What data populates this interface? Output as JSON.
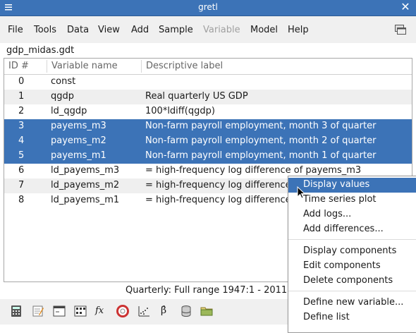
{
  "window": {
    "title": "gretl"
  },
  "menubar": {
    "items": [
      "File",
      "Tools",
      "Data",
      "View",
      "Add",
      "Sample",
      "Variable",
      "Model",
      "Help"
    ],
    "disabled_item": "Variable"
  },
  "dataset": {
    "filename": "gdp_midas.gdt"
  },
  "table": {
    "headers": [
      "ID #",
      "Variable name",
      "Descriptive label"
    ],
    "rows": [
      {
        "id": "0",
        "name": "const",
        "label": ""
      },
      {
        "id": "1",
        "name": "qgdp",
        "label": "Real quarterly US GDP"
      },
      {
        "id": "2",
        "name": "ld_qgdp",
        "label": "100*ldiff(qgdp)"
      },
      {
        "id": "3",
        "name": "payems_m3",
        "label": "Non-farm payroll employment, month 3 of quarter"
      },
      {
        "id": "4",
        "name": "payems_m2",
        "label": "Non-farm payroll employment, month 2 of quarter"
      },
      {
        "id": "5",
        "name": "payems_m1",
        "label": "Non-farm payroll employment, month 1 of quarter"
      },
      {
        "id": "6",
        "name": "ld_payems_m3",
        "label": "= high-frequency log difference of payems_m3"
      },
      {
        "id": "7",
        "name": "ld_payems_m2",
        "label": "= high-frequency log difference"
      },
      {
        "id": "8",
        "name": "ld_payems_m1",
        "label": "= high-frequency log difference"
      }
    ]
  },
  "status": {
    "text": "Quarterly: Full range 1947:1 - 2011:"
  },
  "context_menu": {
    "items": [
      "Display values",
      "Time series plot",
      "Add logs...",
      "Add differences...",
      "Display components",
      "Edit components",
      "Delete components",
      "Define new variable...",
      "Define list"
    ],
    "highlighted": "Display values"
  },
  "colors": {
    "selection": "#3c73b7",
    "titlebar": "#3c73b7"
  },
  "toolbar": {
    "icons": [
      "calculator-icon",
      "notepad-icon",
      "terminal-icon",
      "session-icon",
      "function-icon",
      "help-icon",
      "graph-icon",
      "beta-icon",
      "database-icon",
      "folder-icon"
    ],
    "fx_label": "fx",
    "beta_label": "β̂"
  }
}
